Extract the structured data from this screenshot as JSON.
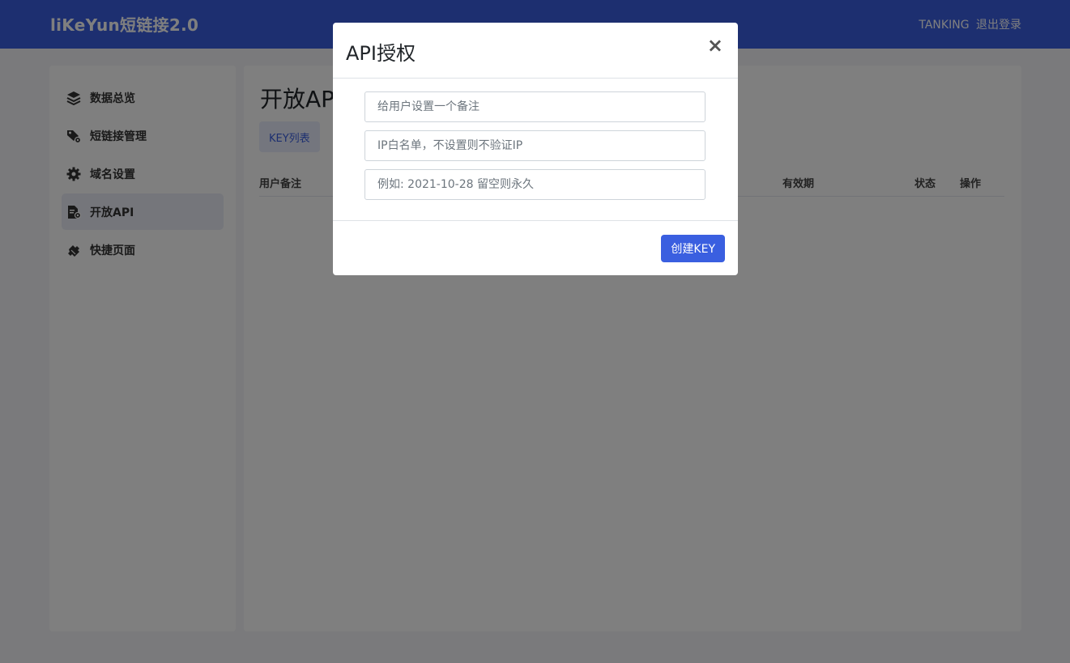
{
  "header": {
    "brand": "liKeYun短链接2.0",
    "username": "TANKING",
    "logout_label": "退出登录"
  },
  "sidebar": {
    "items": [
      {
        "label": "数据总览",
        "icon": "layers-icon"
      },
      {
        "label": "短链接管理",
        "icon": "tag-gear-icon"
      },
      {
        "label": "域名设置",
        "icon": "gear-icon"
      },
      {
        "label": "开放API",
        "icon": "api-doc-icon",
        "active": true
      },
      {
        "label": "快捷页面",
        "icon": "plugin-icon"
      }
    ]
  },
  "main": {
    "title": "开放API",
    "tab_label": "KEY列表",
    "table_headers": [
      "用户备注",
      "有效期",
      "状态",
      "操作"
    ]
  },
  "modal": {
    "title": "API授权",
    "close_symbol": "×",
    "remark_placeholder": "给用户设置一个备注",
    "ip_placeholder": "IP白名单，不设置则不验证IP",
    "expire_placeholder": "例如: 2021-10-28 留空则永久",
    "submit_label": "创建KEY"
  },
  "colors": {
    "primary": "#3a5fe0",
    "overlay": "rgba(0,0,0,0.5)"
  }
}
